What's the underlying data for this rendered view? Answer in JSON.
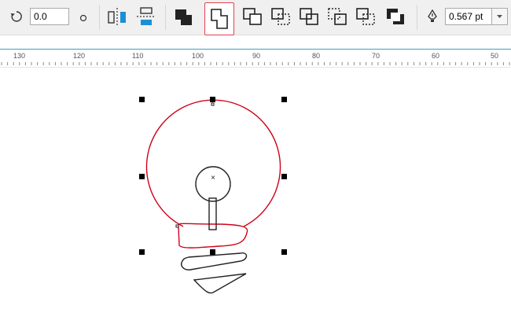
{
  "toolbar": {
    "rotation_value": "0.0",
    "outline_width_value": "0.567 pt",
    "buttons": [
      "rotate-icon",
      "degree-icon",
      "mirror-horizontal-button",
      "mirror-vertical-button",
      "combine-button",
      "weld-button",
      "trim-button",
      "intersect-button",
      "simplify-button",
      "front-minus-back-button",
      "back-minus-front-button",
      "create-boundary-button"
    ],
    "accent_color": "#e8414d",
    "pen_icon": "outline-pen-icon",
    "dropdown_icon": "chevron-down-icon"
  },
  "ruler": {
    "labels": [
      "130",
      "120",
      "110",
      "100",
      "90",
      "80",
      "70",
      "60",
      "50"
    ],
    "color": "#3aa0c8"
  },
  "canvas": {
    "selection_color": "#d0021b",
    "object_color": "#222222"
  }
}
